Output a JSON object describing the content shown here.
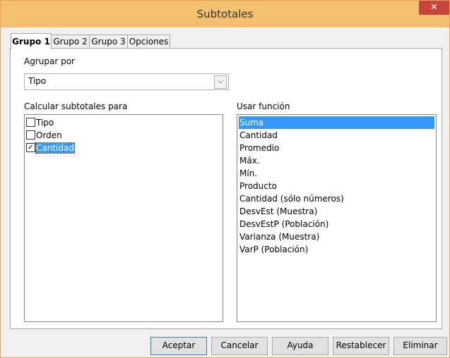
{
  "window": {
    "title": "Subtotales",
    "close_glyph": "✕"
  },
  "tabs": [
    {
      "label": "Grupo 1",
      "active": true
    },
    {
      "label": "Grupo 2",
      "active": false
    },
    {
      "label": "Grupo 3",
      "active": false
    },
    {
      "label": "Opciones",
      "active": false
    }
  ],
  "group_by": {
    "label": "Agrupar por",
    "value": "Tipo"
  },
  "subtotals_for": {
    "label": "Calcular subtotales para",
    "items": [
      {
        "label": "Tipo",
        "checked": false
      },
      {
        "label": "Orden",
        "checked": false
      },
      {
        "label": "Cantidad",
        "checked": true,
        "selected": true
      }
    ]
  },
  "use_function": {
    "label": "Usar función",
    "items": [
      "Suma",
      "Cantidad",
      "Promedio",
      "Máx.",
      "Mín.",
      "Producto",
      "Cantidad (sólo números)",
      "DesvEst (Muestra)",
      "DesvEstP (Población)",
      "Varianza (Muestra)",
      "VarP (Población)"
    ],
    "selected": "Suma"
  },
  "buttons": {
    "ok": "Aceptar",
    "cancel": "Cancelar",
    "help": "Ayuda",
    "reset": "Restablecer",
    "delete": "Eliminar"
  },
  "colors": {
    "titlebar": "#f3c06f",
    "selection": "#3399ff",
    "close": "#c7443c"
  },
  "icons": {
    "dropdown": "chevron-down-icon",
    "checkmark": "check-icon"
  }
}
